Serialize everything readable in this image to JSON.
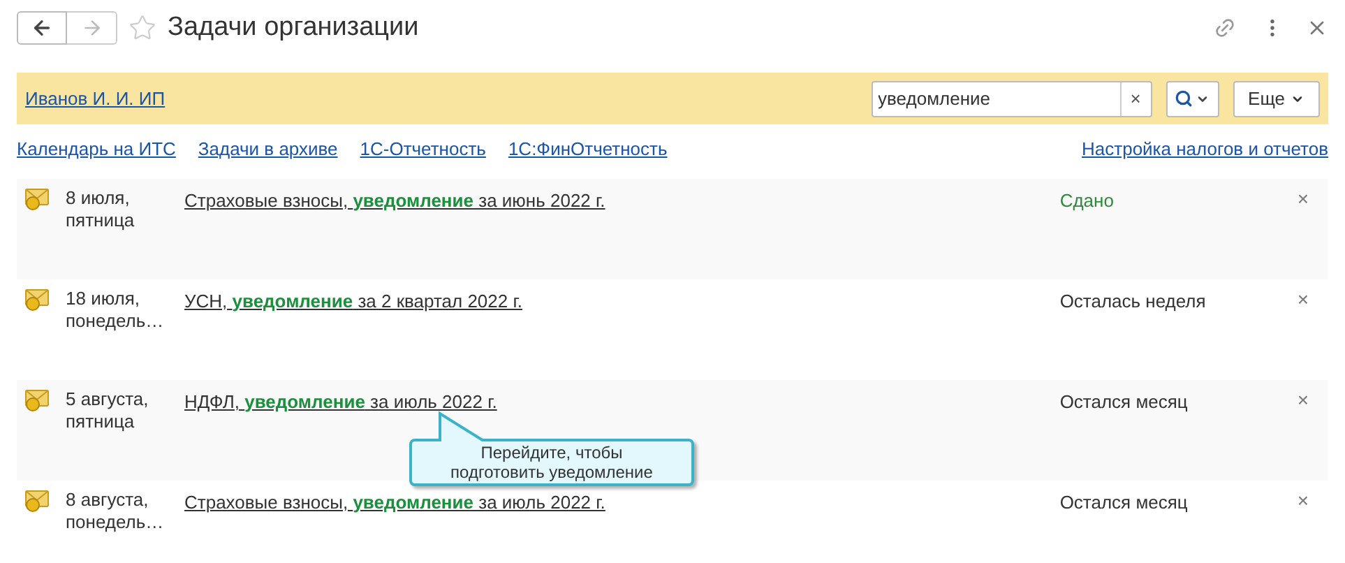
{
  "window": {
    "title": "Задачи организации"
  },
  "organization": "Иванов И. И. ИП",
  "search": {
    "value": "уведомление",
    "clear": "×"
  },
  "more_button": "Еще",
  "links": [
    "Календарь на ИТС",
    "Задачи в архиве",
    "1С-Отчетность",
    "1С:ФинОтчетность"
  ],
  "settings_link": "Настройка налогов и отчетов",
  "tasks": [
    {
      "date": "8 июля,",
      "weekday": "пятница",
      "title": "Страховые взносы, **уведомление** за июнь 2022 г.",
      "status": "Сдано",
      "done": true
    },
    {
      "date": "18 июля,",
      "weekday": "понедель…",
      "title": "УСН, **уведомление** за 2 квартал 2022 г.",
      "status": "Осталась неделя",
      "done": false
    },
    {
      "date": "5 августа,",
      "weekday": "пятница",
      "title": "НДФЛ, **уведомление** за июль 2022 г.",
      "status": "Остался месяц",
      "done": false,
      "tooltip": "Перейдите, чтобы подготовить уведомление"
    },
    {
      "date": "8 августа,",
      "weekday": "понедель…",
      "title": "Страховые взносы, **уведомление** за июль 2022 г.",
      "status": "Остался месяц",
      "done": false
    }
  ],
  "remove_mark": "×"
}
